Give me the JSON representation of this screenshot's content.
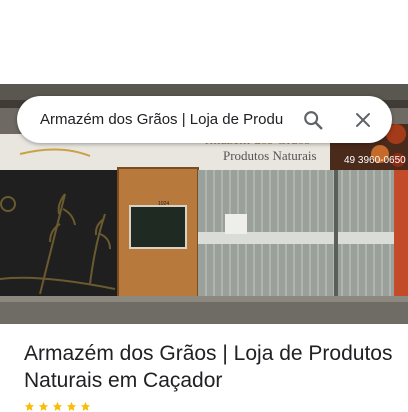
{
  "search": {
    "query": "Armazém dos Grãos | Loja de Produ"
  },
  "place": {
    "title": "Armazém dos Grãos | Loja de Produtos Naturais em Caçador"
  },
  "photo": {
    "sign_text": "Produtos Naturais",
    "sign_title_partial": "rmazém dos Grãos",
    "phone": "49 3960-0650",
    "door_number": "1024"
  },
  "icons": {
    "search": "search-icon",
    "close": "close-icon",
    "star": "star-icon"
  },
  "colors": {
    "icon": "#5f6368",
    "title": "#202124",
    "star": "#fbbc04"
  }
}
